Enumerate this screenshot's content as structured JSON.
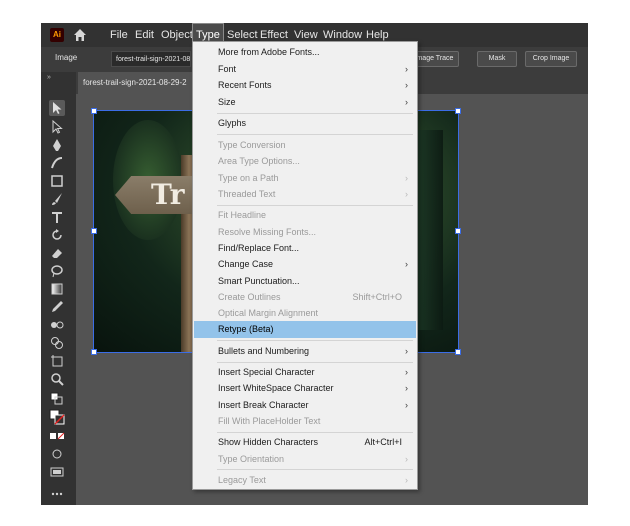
{
  "app": {
    "logo_text": "Ai"
  },
  "menubar": {
    "items": [
      "File",
      "Edit",
      "Object",
      "Type",
      "Select",
      "Effect",
      "View",
      "Window",
      "Help"
    ],
    "active": "Type"
  },
  "control_bar": {
    "image_label": "Image",
    "file_field": "forest-trail-sign-2021-08",
    "buttons": [
      "Image Trace",
      "Mask",
      "Crop Image"
    ]
  },
  "document_tab": {
    "title": "forest-trail-sign-2021-08-29-2"
  },
  "canvas": {
    "sign_text": "Tr"
  },
  "type_menu": {
    "items": [
      {
        "label": "More from Adobe Fonts...",
        "enabled": true
      },
      {
        "label": "Font",
        "enabled": true,
        "submenu": true
      },
      {
        "label": "Recent Fonts",
        "enabled": true,
        "submenu": true
      },
      {
        "label": "Size",
        "enabled": true,
        "submenu": true
      },
      {
        "label": "Glyphs",
        "enabled": true
      },
      {
        "label": "Type Conversion",
        "enabled": false
      },
      {
        "label": "Area Type Options...",
        "enabled": false
      },
      {
        "label": "Type on a Path",
        "enabled": false,
        "submenu": true
      },
      {
        "label": "Threaded Text",
        "enabled": false,
        "submenu": true
      },
      {
        "label": "Fit Headline",
        "enabled": false
      },
      {
        "label": "Resolve Missing Fonts...",
        "enabled": false
      },
      {
        "label": "Find/Replace Font...",
        "enabled": true
      },
      {
        "label": "Change Case",
        "enabled": true,
        "submenu": true
      },
      {
        "label": "Smart Punctuation...",
        "enabled": true
      },
      {
        "label": "Create Outlines",
        "enabled": false,
        "shortcut": "Shift+Ctrl+O"
      },
      {
        "label": "Optical Margin Alignment",
        "enabled": false
      },
      {
        "label": "Retype (Beta)",
        "enabled": true,
        "highlighted": true
      },
      {
        "label": "Bullets and Numbering",
        "enabled": true,
        "submenu": true
      },
      {
        "label": "Insert Special Character",
        "enabled": true,
        "submenu": true
      },
      {
        "label": "Insert WhiteSpace Character",
        "enabled": true,
        "submenu": true
      },
      {
        "label": "Insert Break Character",
        "enabled": true,
        "submenu": true
      },
      {
        "label": "Fill With PlaceHolder Text",
        "enabled": false
      },
      {
        "label": "Show Hidden Characters",
        "enabled": true,
        "shortcut": "Alt+Ctrl+I"
      },
      {
        "label": "Type Orientation",
        "enabled": false,
        "submenu": true
      },
      {
        "label": "Legacy Text",
        "enabled": false,
        "submenu": true
      }
    ]
  },
  "colors": {
    "highlight": "#93c3ea",
    "app_bg": "#535353",
    "menubar_bg": "#323232",
    "selection": "#3b6de6"
  }
}
